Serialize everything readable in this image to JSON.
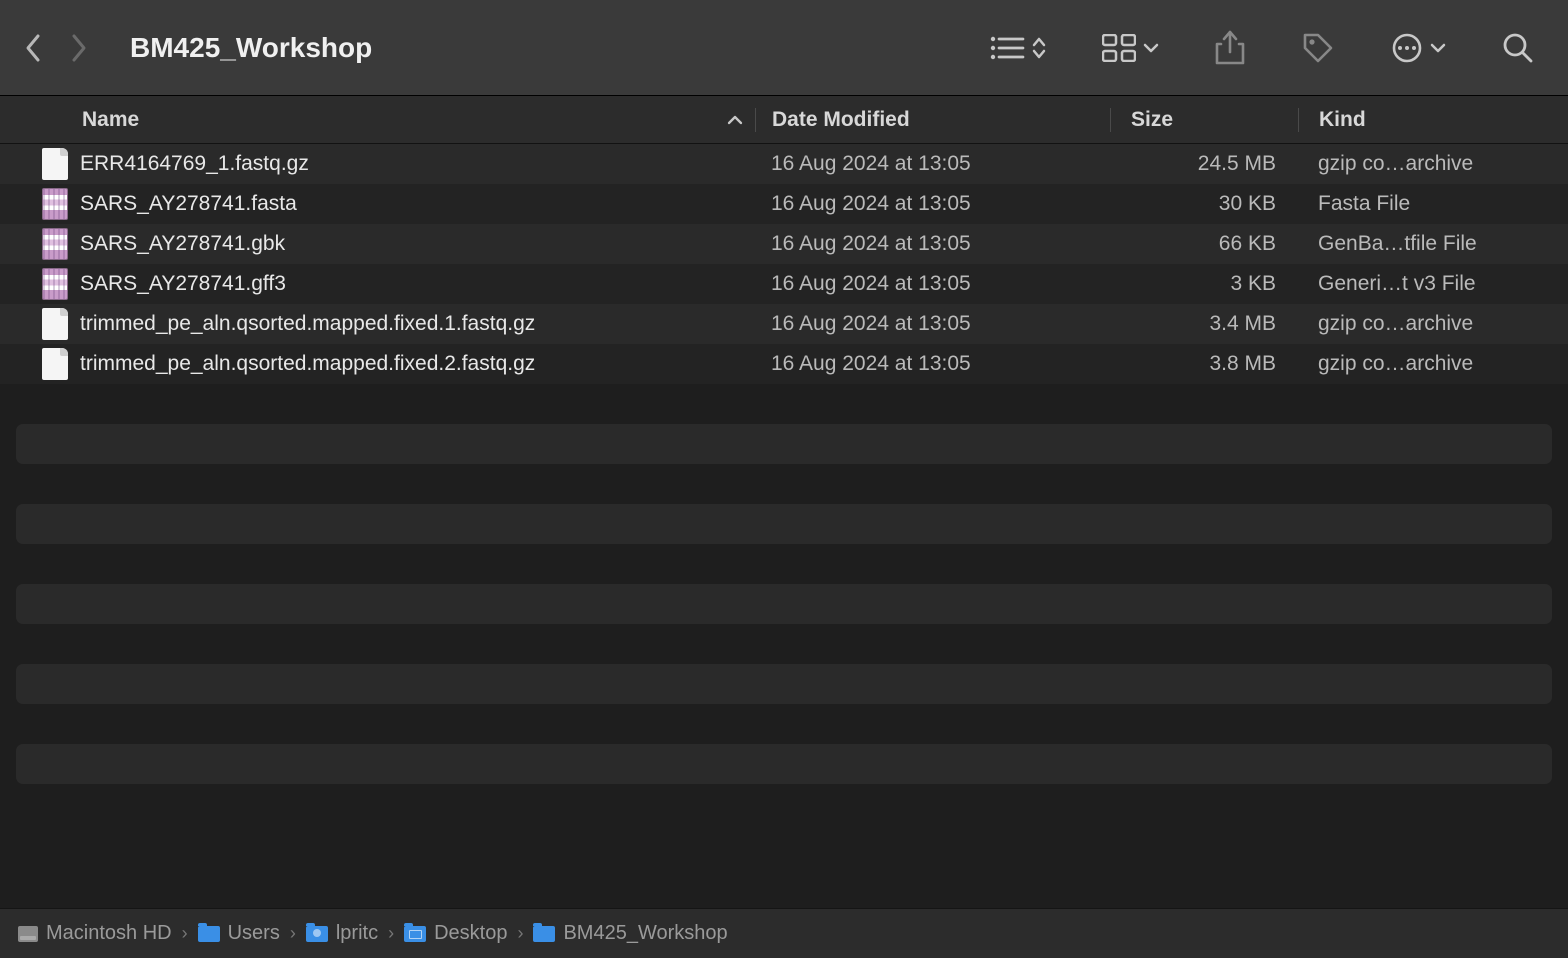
{
  "window": {
    "title": "BM425_Workshop"
  },
  "columns": {
    "name": "Name",
    "date": "Date Modified",
    "size": "Size",
    "kind": "Kind"
  },
  "files": [
    {
      "name": "ERR4164769_1.fastq.gz",
      "date": "16 Aug 2024 at 13:05",
      "size": "24.5 MB",
      "kind": "gzip co…archive",
      "iconType": "doc"
    },
    {
      "name": "SARS_AY278741.fasta",
      "date": "16 Aug 2024 at 13:05",
      "size": "30 KB",
      "kind": "Fasta File",
      "iconType": "bio"
    },
    {
      "name": "SARS_AY278741.gbk",
      "date": "16 Aug 2024 at 13:05",
      "size": "66 KB",
      "kind": "GenBa…tfile File",
      "iconType": "bio"
    },
    {
      "name": "SARS_AY278741.gff3",
      "date": "16 Aug 2024 at 13:05",
      "size": "3 KB",
      "kind": "Generi…t v3 File",
      "iconType": "bio"
    },
    {
      "name": "trimmed_pe_aln.qsorted.mapped.fixed.1.fastq.gz",
      "date": "16 Aug 2024 at 13:05",
      "size": "3.4 MB",
      "kind": "gzip co…archive",
      "iconType": "doc"
    },
    {
      "name": "trimmed_pe_aln.qsorted.mapped.fixed.2.fastq.gz",
      "date": "16 Aug 2024 at 13:05",
      "size": "3.8 MB",
      "kind": "gzip co…archive",
      "iconType": "doc"
    }
  ],
  "pathbar": [
    {
      "label": "Macintosh HD",
      "icon": "disk"
    },
    {
      "label": "Users",
      "icon": "folder"
    },
    {
      "label": "lpritc",
      "icon": "folder-user"
    },
    {
      "label": "Desktop",
      "icon": "folder-desktop"
    },
    {
      "label": "BM425_Workshop",
      "icon": "folder"
    }
  ]
}
